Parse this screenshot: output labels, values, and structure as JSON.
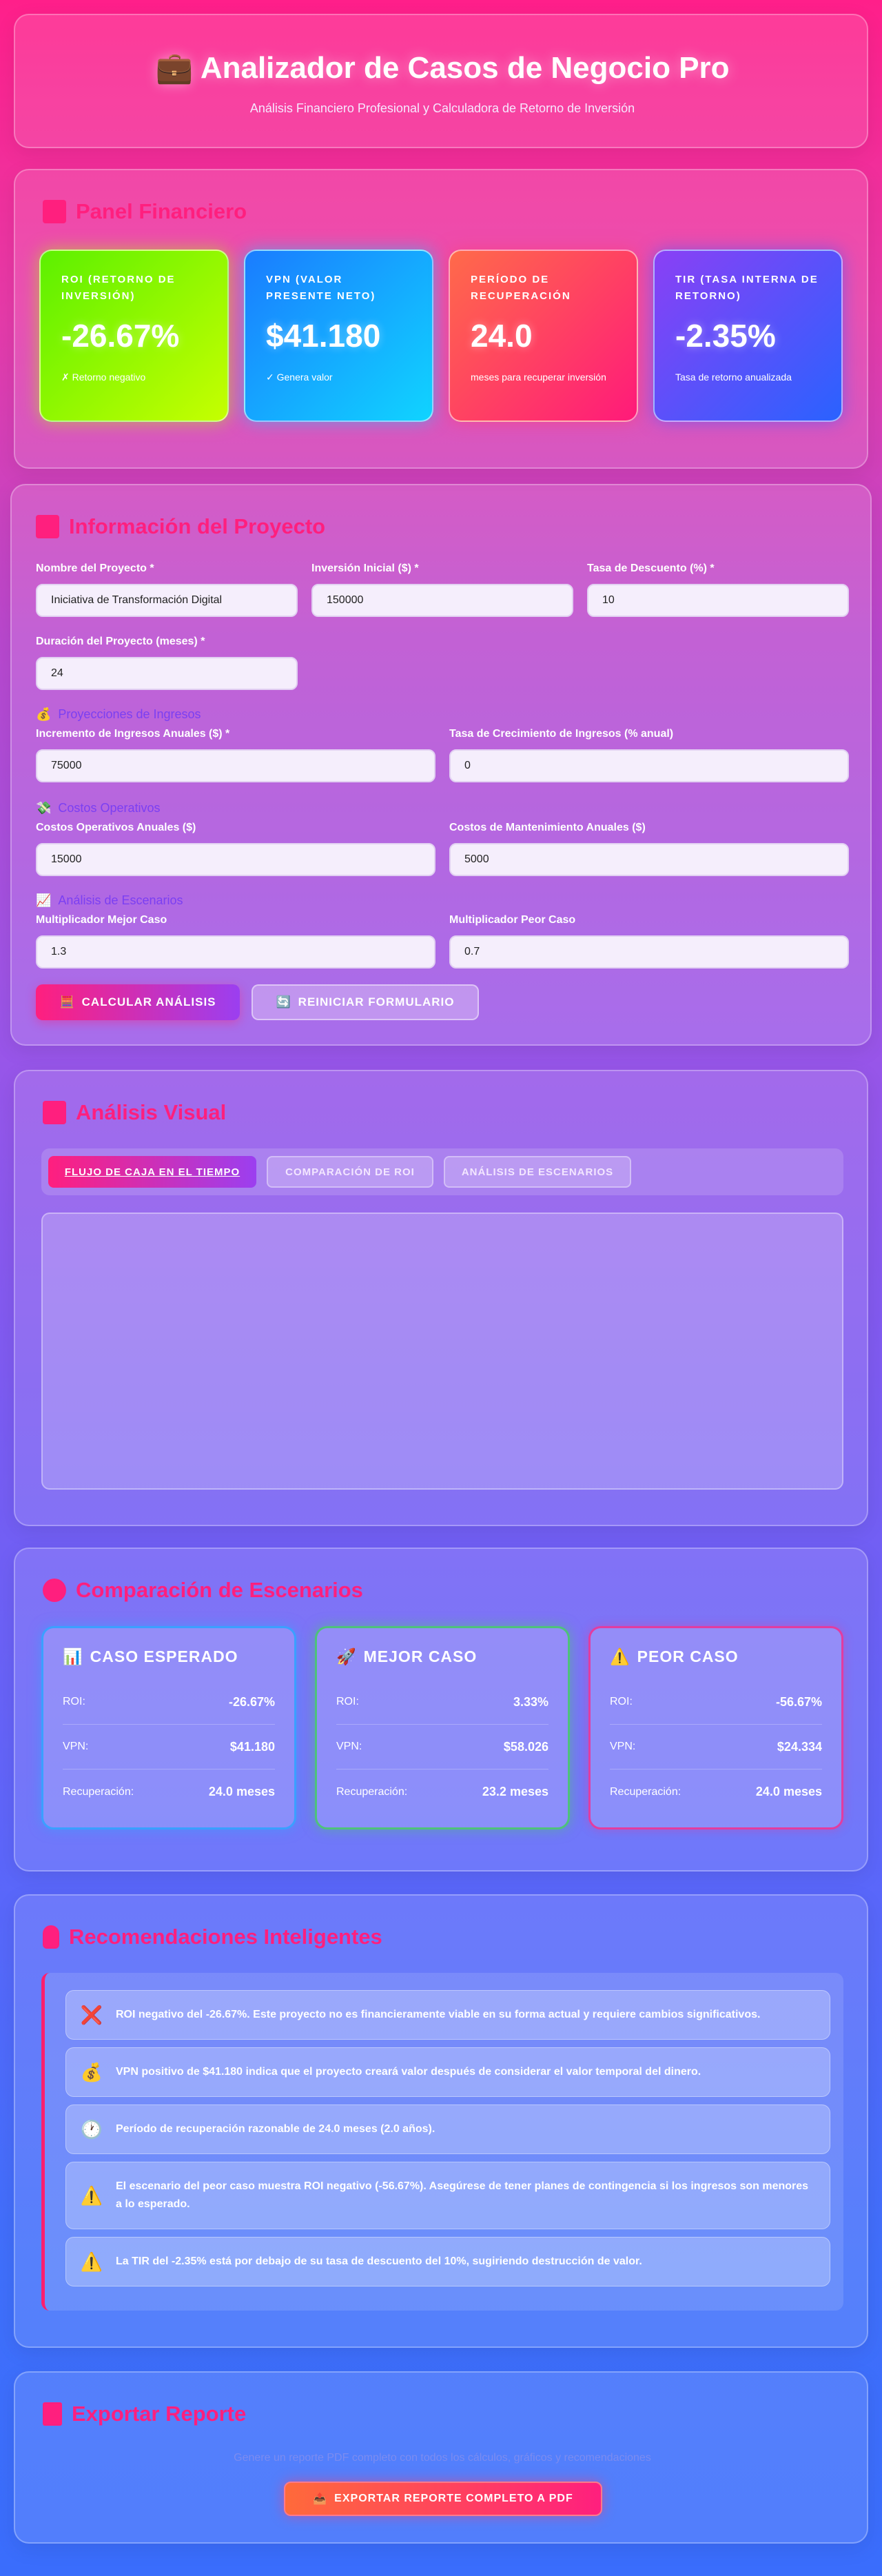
{
  "header": {
    "icon": "briefcase-icon",
    "title": "Analizador de Casos de Negocio Pro",
    "subtitle": "Análisis Financiero Profesional y Calculadora de Retorno de Inversión"
  },
  "dashboard": {
    "title": "Panel Financiero",
    "kpis": [
      {
        "label": "ROI (Retorno de Inversión)",
        "value": "-26.67%",
        "note": "✗ Retorno negativo"
      },
      {
        "label": "VPN (Valor Presente Neto)",
        "value": "$41.180",
        "note": "✓ Genera valor"
      },
      {
        "label": "Período de Recuperación",
        "value": "24.0",
        "note": "meses para recuperar inversión"
      },
      {
        "label": "TIR (Tasa Interna de Retorno)",
        "value": "-2.35%",
        "note": "Tasa de retorno anualizada"
      }
    ]
  },
  "project": {
    "title": "Información del Proyecto",
    "fields": {
      "name": {
        "label": "Nombre del Proyecto *",
        "value": "Iniciativa de Transformación Digital"
      },
      "investment": {
        "label": "Inversión Inicial ($) *",
        "value": "150000"
      },
      "discount": {
        "label": "Tasa de Descuento (%) *",
        "value": "10"
      },
      "duration": {
        "label": "Duración del Proyecto (meses) *",
        "value": "24"
      },
      "revenue": {
        "label": "Incremento de Ingresos Anuales ($) *",
        "value": "75000"
      },
      "growth": {
        "label": "Tasa de Crecimiento de Ingresos (% anual)",
        "value": "0"
      },
      "opex": {
        "label": "Costos Operativos Anuales ($)",
        "value": "15000"
      },
      "maint": {
        "label": "Costos de Mantenimiento Anuales ($)",
        "value": "5000"
      },
      "best": {
        "label": "Multiplicador Mejor Caso",
        "value": "1.3"
      },
      "worst": {
        "label": "Multiplicador Peor Caso",
        "value": "0.7"
      }
    },
    "subheads": {
      "revenue": "Proyecciones de Ingresos",
      "costs": "Costos Operativos",
      "scenarios": "Análisis de Escenarios"
    },
    "buttons": {
      "calculate": "CALCULAR ANÁLISIS",
      "reset": "REINICIAR FORMULARIO"
    }
  },
  "visual": {
    "title": "Análisis Visual",
    "tabs": [
      "Flujo de Caja en el Tiempo",
      "Comparación de ROI",
      "Análisis de Escenarios"
    ]
  },
  "scenarios": {
    "title": "Comparación de Escenarios",
    "cards": [
      {
        "title": "CASO ESPERADO",
        "icon": "bar-chart-icon",
        "roi": "-26.67%",
        "npv": "$41.180",
        "payback": "24.0 meses",
        "color": "#3aa0ff"
      },
      {
        "title": "MEJOR CASO",
        "icon": "rocket-icon",
        "roi": "3.33%",
        "npv": "$58.026",
        "payback": "23.2 meses",
        "color": "#4ec27a"
      },
      {
        "title": "PEOR CASO",
        "icon": "warning-icon",
        "roi": "-56.67%",
        "npv": "$24.334",
        "payback": "24.0 meses",
        "color": "#e23ca0"
      }
    ],
    "labels": {
      "roi": "ROI:",
      "npv": "VPN:",
      "payback": "Recuperación:"
    }
  },
  "recommendations": {
    "title": "Recomendaciones Inteligentes",
    "items": [
      {
        "icon": "❌",
        "text": "ROI negativo del -26.67%. Este proyecto no es financieramente viable en su forma actual y requiere cambios significativos."
      },
      {
        "icon": "💰",
        "text": "VPN positivo de $41.180 indica que el proyecto creará valor después de considerar el valor temporal del dinero."
      },
      {
        "icon": "🕐",
        "text": "Período de recuperación razonable de 24.0 meses (2.0 años)."
      },
      {
        "icon": "⚠️",
        "text": "El escenario del peor caso muestra ROI negativo (-56.67%). Asegúrese de tener planes de contingencia si los ingresos son menores a lo esperado."
      },
      {
        "icon": "⚠️",
        "text": "La TIR del -2.35% está por debajo de su tasa de descuento del 10%, sugiriendo destrucción de valor."
      }
    ]
  },
  "export": {
    "title": "Exportar Reporte",
    "description": "Genere un reporte PDF completo con todos los cálculos, gráficos y recomendaciones",
    "button": "EXPORTAR REPORTE COMPLETO A PDF"
  }
}
